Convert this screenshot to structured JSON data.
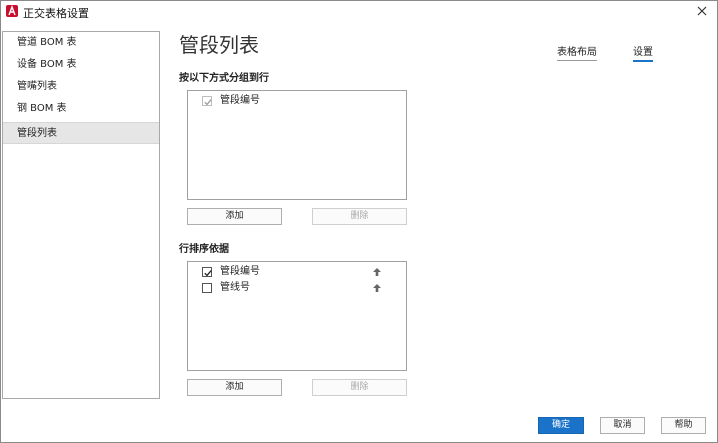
{
  "window": {
    "title": "正交表格设置"
  },
  "sidebar": {
    "items": [
      {
        "label": "管道 BOM 表"
      },
      {
        "label": "设备 BOM 表"
      },
      {
        "label": "管嘴列表"
      },
      {
        "label": "钢 BOM 表"
      },
      {
        "label": "管段列表",
        "selected": true
      }
    ]
  },
  "main": {
    "title": "管段列表",
    "tabs": [
      {
        "label": "表格布局"
      },
      {
        "label": "设置",
        "active": true
      }
    ],
    "group_rows": {
      "label": "按以下方式分组到行",
      "items": [
        {
          "label": "管段编号",
          "checked": true,
          "disabled": true
        }
      ],
      "add_label": "添加",
      "delete_label": "删除"
    },
    "sort_rows": {
      "label": "行排序依据",
      "items": [
        {
          "label": "管段编号",
          "checked": true,
          "icon": "arrow-up-icon"
        },
        {
          "label": "管线号",
          "checked": false,
          "icon": "arrow-up-icon"
        }
      ],
      "add_label": "添加",
      "delete_label": "删除"
    }
  },
  "footer": {
    "ok_label": "确定",
    "cancel_label": "取消",
    "help_label": "帮助"
  },
  "colors": {
    "accent": "#1a73c9",
    "brand_icon": "#c8102e",
    "selected_row": "#e6e6e6"
  }
}
